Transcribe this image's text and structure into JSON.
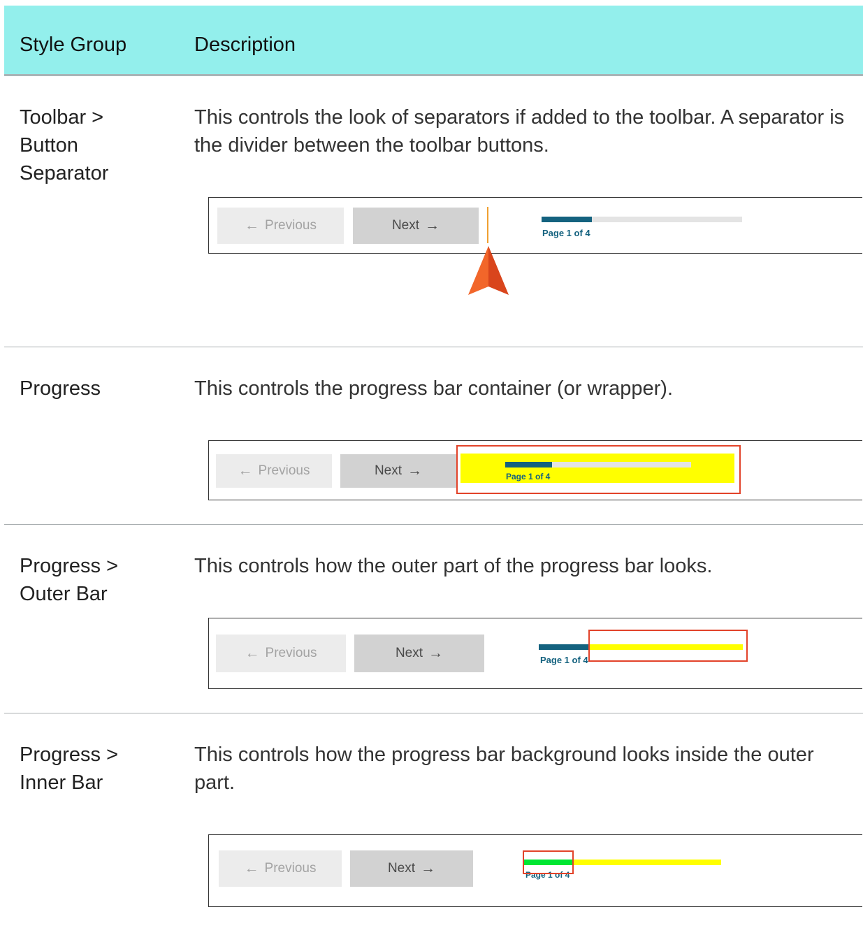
{
  "table": {
    "headers": [
      "Style Group",
      "Description"
    ],
    "rows": [
      {
        "label_lines": [
          "Toolbar >",
          "Button",
          "Separator"
        ],
        "description": "This controls the look of separators if added to the toolbar. A separator is the divider between the toolbar buttons."
      },
      {
        "label_lines": [
          "Progress"
        ],
        "description": "This controls the progress bar container (or wrapper)."
      },
      {
        "label_lines": [
          "Progress >",
          "Outer Bar"
        ],
        "description": "This controls how the outer part of the progress bar looks."
      },
      {
        "label_lines": [
          "Progress >",
          "Inner Bar"
        ],
        "description": "This controls how the progress bar background looks inside the outer part."
      }
    ]
  },
  "toolbar": {
    "prev_label": "Previous",
    "next_label": "Next",
    "prev_arrow": "←",
    "next_arrow": "→",
    "page_text": "Page 1 of 4",
    "progress_fraction": 0.25
  },
  "colors": {
    "header_bg": "#93efec",
    "progress_fill": "#14627f",
    "highlight_yellow": "#ffff00",
    "highlight_green": "#00e632",
    "callout_red": "#e2432a",
    "separator_orange": "#f0a030",
    "pointer_orange": "#e8501e"
  }
}
